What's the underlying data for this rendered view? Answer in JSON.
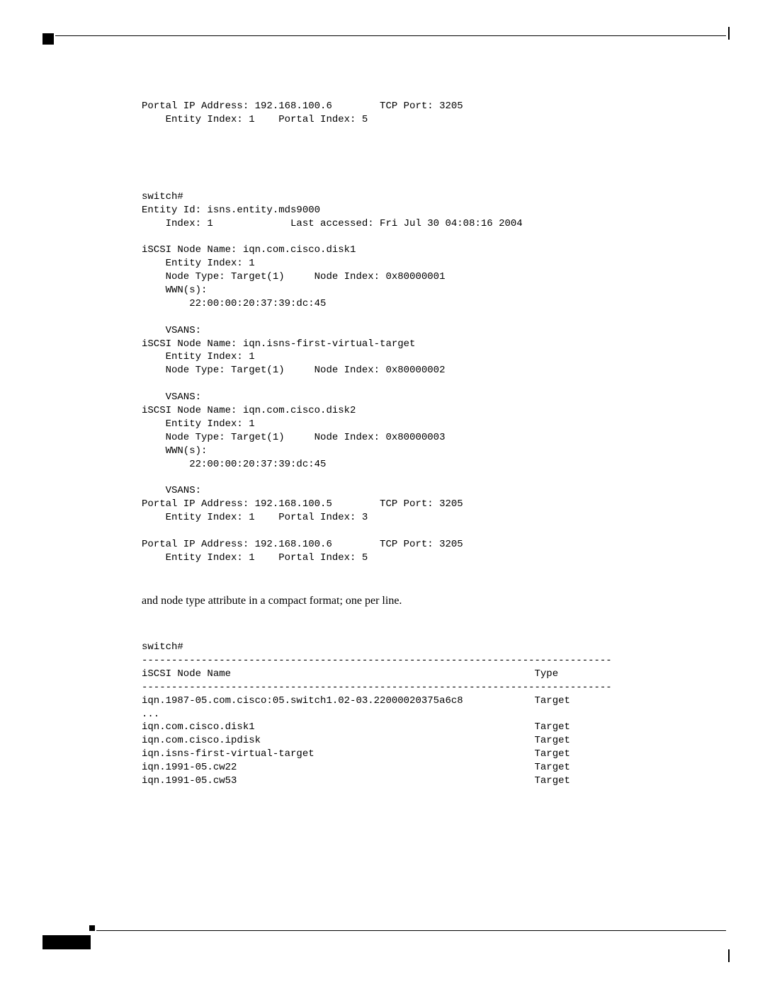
{
  "block1": "Portal IP Address: 192.168.100.6        TCP Port: 3205\n    Entity Index: 1    Portal Index: 5",
  "block2": "switch#\nEntity Id: isns.entity.mds9000\n    Index: 1             Last accessed: Fri Jul 30 04:08:16 2004\n\niSCSI Node Name: iqn.com.cisco.disk1\n    Entity Index: 1\n    Node Type: Target(1)     Node Index: 0x80000001\n    WWN(s):\n        22:00:00:20:37:39:dc:45\n\n    VSANS:\niSCSI Node Name: iqn.isns-first-virtual-target\n    Entity Index: 1\n    Node Type: Target(1)     Node Index: 0x80000002\n\n    VSANS:\niSCSI Node Name: iqn.com.cisco.disk2\n    Entity Index: 1\n    Node Type: Target(1)     Node Index: 0x80000003\n    WWN(s):\n        22:00:00:20:37:39:dc:45\n\n    VSANS:\nPortal IP Address: 192.168.100.5        TCP Port: 3205\n    Entity Index: 1    Portal Index: 3\n\nPortal IP Address: 192.168.100.6        TCP Port: 3205\n    Entity Index: 1    Portal Index: 5",
  "bodytext": "and node type attribute in a compact format; one per line.",
  "block3": "switch#\n-------------------------------------------------------------------------------\niSCSI Node Name                                                   Type\n-------------------------------------------------------------------------------\niqn.1987-05.com.cisco:05.switch1.02-03.22000020375a6c8            Target\n...\niqn.com.cisco.disk1                                               Target\niqn.com.cisco.ipdisk                                              Target\niqn.isns-first-virtual-target                                     Target\niqn.1991-05.cw22                                                  Target\niqn.1991-05.cw53                                                  Target"
}
